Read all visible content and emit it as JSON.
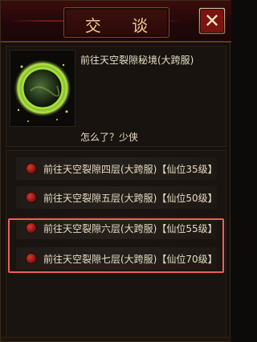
{
  "window": {
    "title": "交 谈",
    "close_symbol": "✕"
  },
  "npc": {
    "name": "前往天空裂隙秘境(大跨服)",
    "dialog": "怎么了？少侠",
    "portrait_icon": "glowing-portal-icon"
  },
  "options": [
    {
      "label": "前往天空裂隙四层(大跨服)【仙位35级】",
      "icon": "red-orb-icon"
    },
    {
      "label": "前往天空裂隙五层(大跨服)【仙位50级】",
      "icon": "red-orb-icon"
    },
    {
      "label": "前往天空裂隙六层(大跨服)【仙位55级】",
      "icon": "red-orb-icon"
    },
    {
      "label": "前往天空裂隙七层(大跨服)【仙位70级】",
      "icon": "red-orb-icon"
    }
  ],
  "colors": {
    "title_text": "#f1c98a",
    "highlight_border": "#ef5d5d",
    "body_text": "#e8ddc6"
  }
}
